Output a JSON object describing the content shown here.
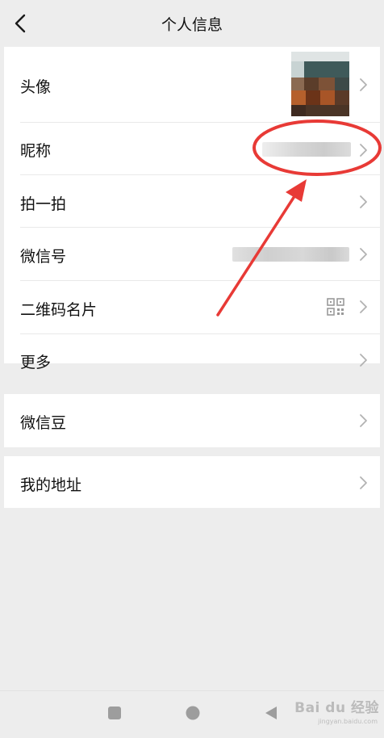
{
  "header": {
    "title": "个人信息"
  },
  "sections": [
    {
      "rows": [
        {
          "label": "头像"
        },
        {
          "label": "昵称"
        },
        {
          "label": "拍一拍"
        },
        {
          "label": "微信号"
        },
        {
          "label": "二维码名片"
        },
        {
          "label": "更多"
        }
      ]
    },
    {
      "rows": [
        {
          "label": "微信豆"
        }
      ]
    },
    {
      "rows": [
        {
          "label": "我的地址"
        }
      ]
    }
  ],
  "icons": {
    "back": "chevron-left-icon",
    "row_arrow": "chevron-right-icon",
    "qr": "qr-code-icon",
    "nav_recent": "square-icon",
    "nav_home": "circle-icon",
    "nav_back": "triangle-left-icon"
  },
  "colors": {
    "background": "#ededed",
    "card": "#ffffff",
    "annotation": "#e83a36",
    "chevron": "#b2b2b2"
  },
  "watermark": {
    "text": "Bai du 经验",
    "sub": "jingyan.baidu.com"
  }
}
